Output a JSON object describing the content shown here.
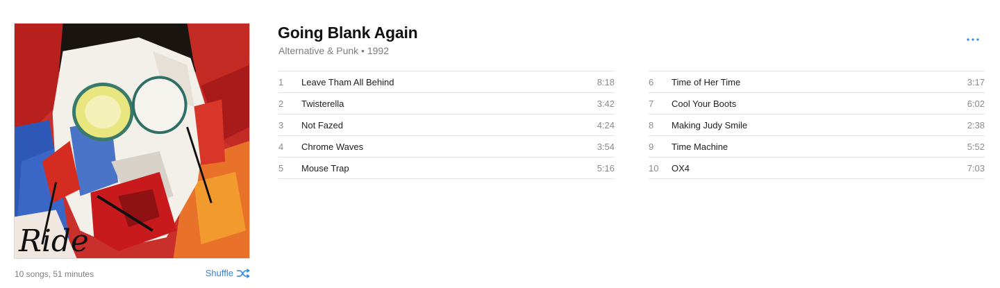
{
  "album": {
    "title": "Going Blank Again",
    "genre_year": "Alternative & Punk • 1992",
    "summary": "10 songs, 51 minutes",
    "shuffle_label": "Shuffle",
    "art_text": "Ride"
  },
  "colors": {
    "accent": "#2b86e4",
    "secondary_text": "#7c7c7c",
    "divider": "#e3e3e3"
  },
  "icons": {
    "more": "more-icon",
    "shuffle": "shuffle-icon"
  },
  "tracks": [
    {
      "num": "1",
      "title": "Leave Tham All Behind",
      "duration": "8:18"
    },
    {
      "num": "2",
      "title": "Twisterella",
      "duration": "3:42"
    },
    {
      "num": "3",
      "title": "Not Fazed",
      "duration": "4:24"
    },
    {
      "num": "4",
      "title": "Chrome Waves",
      "duration": "3:54"
    },
    {
      "num": "5",
      "title": "Mouse Trap",
      "duration": "5:16"
    },
    {
      "num": "6",
      "title": "Time of Her Time",
      "duration": "3:17"
    },
    {
      "num": "7",
      "title": "Cool Your Boots",
      "duration": "6:02"
    },
    {
      "num": "8",
      "title": "Making Judy Smile",
      "duration": "2:38"
    },
    {
      "num": "9",
      "title": "Time Machine",
      "duration": "5:52"
    },
    {
      "num": "10",
      "title": "OX4",
      "duration": "7:03"
    }
  ]
}
